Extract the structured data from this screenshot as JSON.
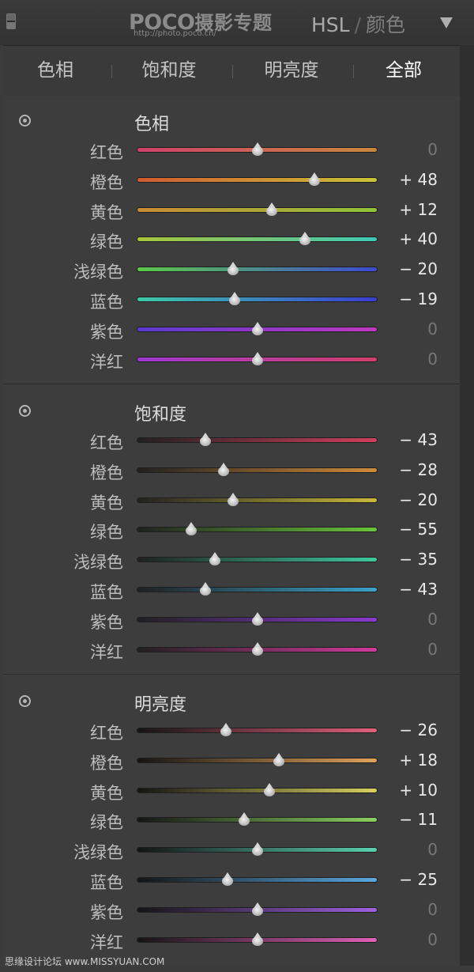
{
  "header": {
    "logo_brand": "POCO",
    "logo_text": "摄影专题",
    "logo_url": "http://photo.poco.cn/",
    "panel_name": "HSL",
    "panel_sep": "/",
    "panel_alt": "颜色"
  },
  "tabs": [
    {
      "label": "色相",
      "active": false
    },
    {
      "label": "饱和度",
      "active": false
    },
    {
      "label": "明亮度",
      "active": false
    },
    {
      "label": "全部",
      "active": true
    }
  ],
  "sections": [
    {
      "title": "色相",
      "rows": [
        {
          "label": "红色",
          "value": "0",
          "num": 0,
          "track": [
            "#d0406a",
            "#c8883c"
          ]
        },
        {
          "label": "橙色",
          "value": "+ 48",
          "num": 48,
          "track": [
            "#d05a32",
            "#c9c436"
          ]
        },
        {
          "label": "黄色",
          "value": "+ 12",
          "num": 12,
          "track": [
            "#c98a34",
            "#8fc43a"
          ]
        },
        {
          "label": "绿色",
          "value": "+ 40",
          "num": 40,
          "track": [
            "#a8c43a",
            "#3fc8b4"
          ]
        },
        {
          "label": "浅绿色",
          "value": "− 20",
          "num": -20,
          "track": [
            "#5cc848",
            "#3d4ad0"
          ]
        },
        {
          "label": "蓝色",
          "value": "− 19",
          "num": -19,
          "track": [
            "#3ec8a8",
            "#3a3ed0"
          ]
        },
        {
          "label": "紫色",
          "value": "0",
          "num": 0,
          "track": [
            "#5a3ad0",
            "#c038c0"
          ]
        },
        {
          "label": "洋红",
          "value": "0",
          "num": 0,
          "track": [
            "#a038d0",
            "#d0406a"
          ]
        }
      ]
    },
    {
      "title": "饱和度",
      "rows": [
        {
          "label": "红色",
          "value": "− 43",
          "num": -43,
          "track": [
            "#202020",
            "#d0405c"
          ]
        },
        {
          "label": "橙色",
          "value": "− 28",
          "num": -28,
          "track": [
            "#202020",
            "#d08a3a"
          ]
        },
        {
          "label": "黄色",
          "value": "− 20",
          "num": -20,
          "track": [
            "#202020",
            "#c9b83a"
          ]
        },
        {
          "label": "绿色",
          "value": "− 55",
          "num": -55,
          "track": [
            "#202020",
            "#6ac43c"
          ]
        },
        {
          "label": "浅绿色",
          "value": "− 35",
          "num": -35,
          "track": [
            "#202020",
            "#3ec89c"
          ]
        },
        {
          "label": "蓝色",
          "value": "− 43",
          "num": -43,
          "track": [
            "#202020",
            "#3aa2c8"
          ]
        },
        {
          "label": "紫色",
          "value": "0",
          "num": 0,
          "track": [
            "#202020",
            "#8a3ad0"
          ]
        },
        {
          "label": "洋红",
          "value": "0",
          "num": 0,
          "track": [
            "#202020",
            "#d03a9c"
          ]
        }
      ]
    },
    {
      "title": "明亮度",
      "rows": [
        {
          "label": "红色",
          "value": "− 26",
          "num": -26,
          "track": [
            "#141414",
            "#e0607c"
          ]
        },
        {
          "label": "橙色",
          "value": "+ 18",
          "num": 18,
          "track": [
            "#141414",
            "#e0a25a"
          ]
        },
        {
          "label": "黄色",
          "value": "+ 10",
          "num": 10,
          "track": [
            "#141414",
            "#d8d060"
          ]
        },
        {
          "label": "绿色",
          "value": "− 11",
          "num": -11,
          "track": [
            "#141414",
            "#8ad060"
          ]
        },
        {
          "label": "浅绿色",
          "value": "0",
          "num": 0,
          "track": [
            "#141414",
            "#5ad0b0"
          ]
        },
        {
          "label": "蓝色",
          "value": "− 25",
          "num": -25,
          "track": [
            "#141414",
            "#5aa8e0"
          ]
        },
        {
          "label": "紫色",
          "value": "0",
          "num": 0,
          "track": [
            "#141414",
            "#a060e0"
          ]
        },
        {
          "label": "洋红",
          "value": "0",
          "num": 0,
          "track": [
            "#141414",
            "#e060b8"
          ]
        }
      ]
    }
  ],
  "watermark": "思缘设计论坛 www.MISSYUAN.COM"
}
